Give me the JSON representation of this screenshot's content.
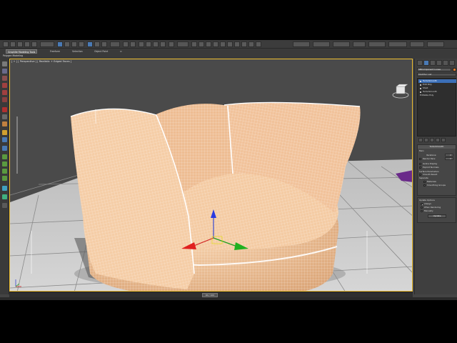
{
  "toolbar": {
    "view_drop": "",
    "named_sel_drop": "",
    "right_drops": [
      "",
      "",
      "",
      "",
      "",
      "",
      "",
      "",
      ""
    ]
  },
  "ribbon": {
    "tabs": [
      "Graphite Modeling Tools",
      "Freeform",
      "Selection",
      "Object Paint",
      "⊙"
    ],
    "sub_label": "Polygon Modeling"
  },
  "viewport": {
    "label": "[ + ] [ Perspective ] [ Realistic + Edged Faces ]",
    "active_border_color": "#f0c030",
    "chair_color": "#f2c49a",
    "wire_color": "#ffffff",
    "floor_color": "#cfcfcf"
  },
  "timeline": {
    "frame": "90 / 100"
  },
  "command_panel": {
    "object_name": "SBComponent Loose",
    "modifier_list": "Modifier List",
    "stack": [
      {
        "label": "TurboSmooth",
        "selected": true
      },
      {
        "label": "Edit Poly",
        "selected": false
      },
      {
        "label": "Shell",
        "selected": false
      },
      {
        "label": "TurboSmooth",
        "selected": false
      },
      {
        "label": "Editable Poly",
        "selected": false
      }
    ],
    "turbosmooth": {
      "title": "TurboSmooth",
      "main_label": "Main",
      "iterations_label": "Iterations:",
      "iterations_value": "2",
      "render_iters_label": "Render Iters:",
      "render_iters_value": "2",
      "isoline_label": "Isoline Display",
      "explicit_normals_label": "Explicit Normals",
      "surface_params_label": "Surface Parameters",
      "smooth_result_label": "Smooth Result",
      "separate_label": "Separate",
      "materials_label": "Materials",
      "smoothing_groups_label": "Smoothing Groups",
      "update_options_label": "Update Options",
      "always_label": "Always",
      "when_rendering_label": "When Rendering",
      "manually_label": "Manually",
      "update_button": "Update"
    }
  }
}
